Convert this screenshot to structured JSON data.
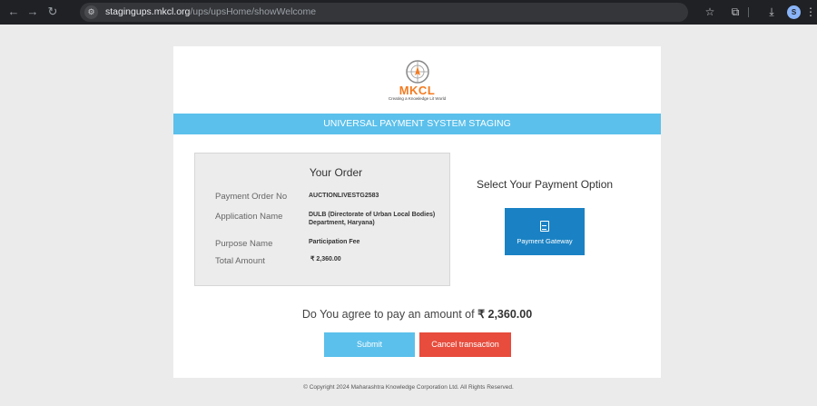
{
  "browser": {
    "url_host": "stagingups.mkcl.org",
    "url_path": "/ups/upsHome/showWelcome",
    "profile_initial": "S"
  },
  "logo": {
    "name": "MKCL",
    "tagline": "Creating a Knowledge Lit World"
  },
  "banner": {
    "title": "UNIVERSAL PAYMENT SYSTEM STAGING"
  },
  "order": {
    "title": "Your Order",
    "rows": [
      {
        "label": "Payment Order No",
        "value": "AUCTIONLIVESTG2583"
      },
      {
        "label": "Application Name",
        "value": "DULB (Directorate of Urban Local Bodies) Department, Haryana)"
      },
      {
        "label": "Purpose Name",
        "value": "Participation Fee"
      },
      {
        "label": "Total Amount",
        "value": "₹  2,360.00"
      }
    ]
  },
  "payment": {
    "title": "Select Your Payment Option",
    "gateway_label": "Payment Gateway"
  },
  "confirm": {
    "text": "Do You agree to pay an amount of",
    "amount": "₹  2,360.00"
  },
  "actions": {
    "submit_label": "Submit",
    "cancel_label": "Cancel transaction"
  },
  "footer": {
    "text": "© Copyright 2024 Maharashtra Knowledge Corporation Ltd. All Rights Reserved."
  },
  "colors": {
    "banner": "#5bc0eb",
    "gateway_button": "#1a82c4",
    "cancel_button": "#e74c3c",
    "logo_accent": "#f47b20"
  }
}
